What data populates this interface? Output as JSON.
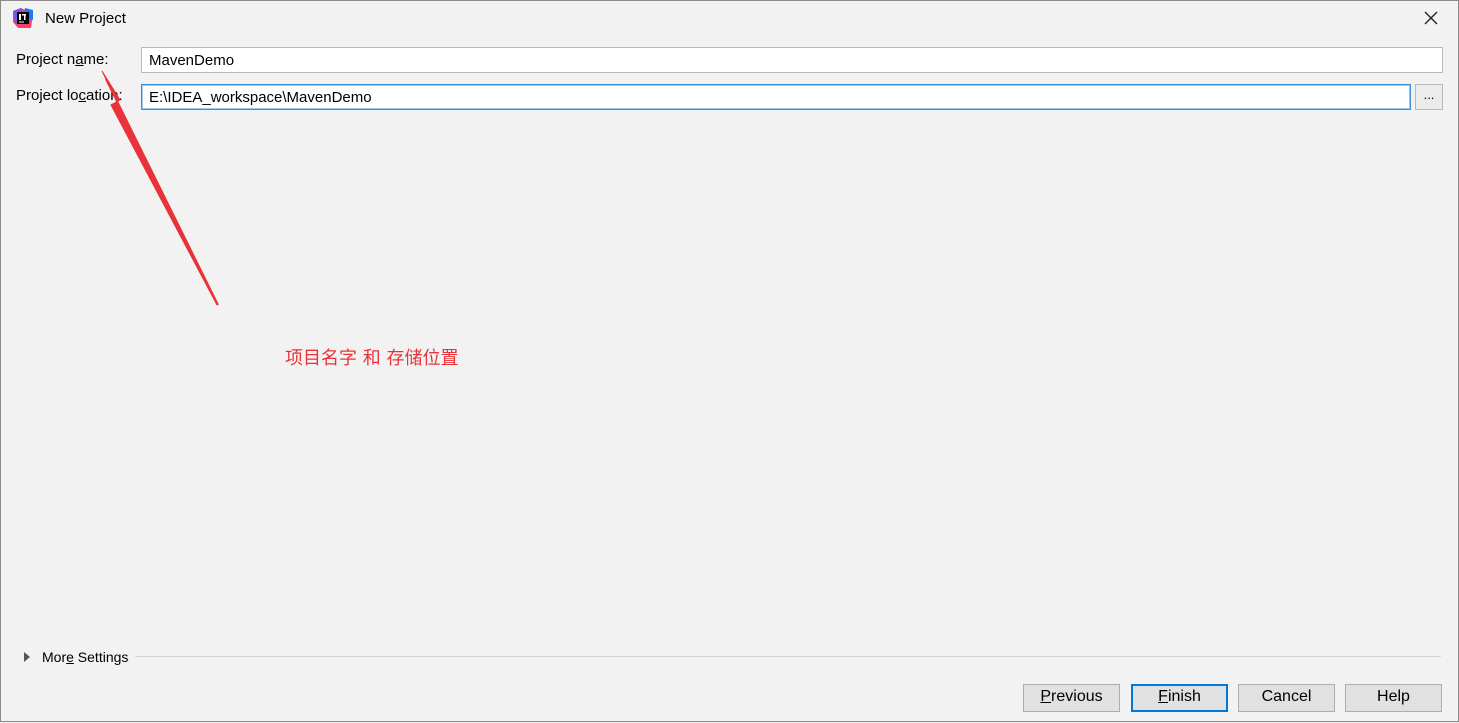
{
  "window": {
    "title": "New Project",
    "app_icon": "intellij-idea-icon",
    "close_icon": "close-icon"
  },
  "form": {
    "name_label_pre": "Project n",
    "name_label_mn": "a",
    "name_label_post": "me:",
    "name_value": "MavenDemo",
    "location_label_pre": "Project lo",
    "location_label_mn": "c",
    "location_label_post": "ation:",
    "location_value": "E:\\IDEA_workspace\\MavenDemo",
    "browse_label": "..."
  },
  "annotation": {
    "text": "项目名字 和  存储位置",
    "color": "#e8333a"
  },
  "more_settings": {
    "pre": "Mor",
    "mn": "e",
    "post": " Settings",
    "icon": "triangle-right-icon"
  },
  "buttons": {
    "previous_mn": "P",
    "previous_rest": "revious",
    "finish_mn": "F",
    "finish_rest": "inish",
    "cancel": "Cancel",
    "help": "Help"
  },
  "colors": {
    "background": "#f2f2f2",
    "focus_border": "#3c8fd6",
    "default_button_border": "#0078d7"
  }
}
